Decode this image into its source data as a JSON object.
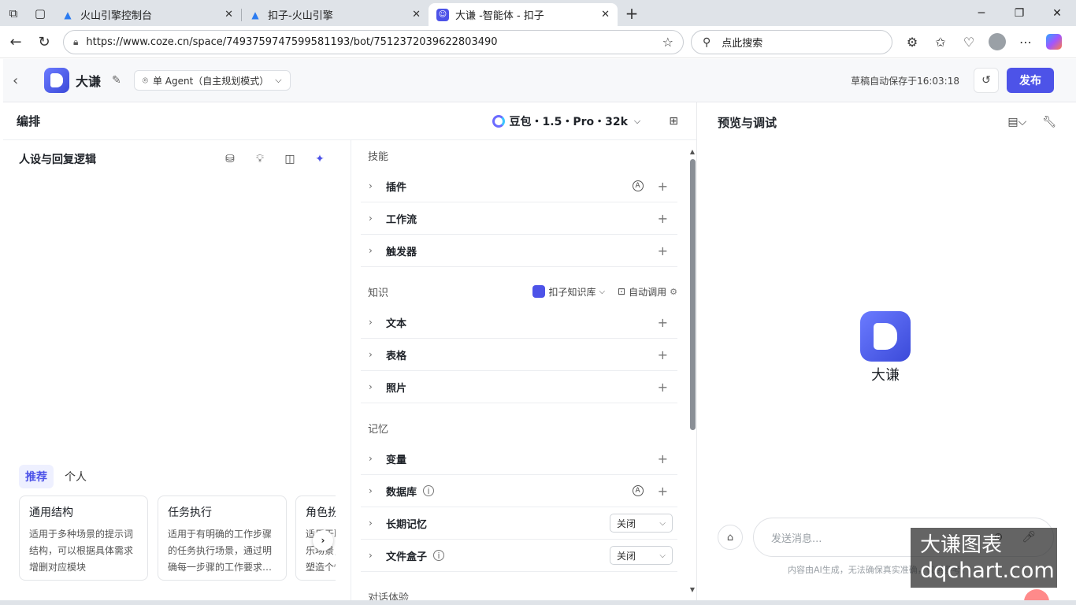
{
  "browser": {
    "tabs": [
      {
        "title": "火山引擎控制台",
        "icon": "volcano-icon",
        "active": false
      },
      {
        "title": "扣子-火山引擎",
        "icon": "volcano-icon",
        "active": false
      },
      {
        "title": "大谦 -智能体 - 扣子",
        "icon": "coze-icon",
        "active": true
      }
    ],
    "url": "https://www.coze.cn/space/7493759747599581193/bot/7512372039622803490",
    "search_placeholder": "点此搜索"
  },
  "header": {
    "bot_name": "大谦",
    "mode_label": "单 Agent（自主规划模式）",
    "autosave": "草稿自动保存于16:03:18",
    "publish_label": "发布"
  },
  "edit": {
    "title": "编排",
    "model": "豆包・1.5・Pro・32k"
  },
  "persona": {
    "title": "人设与回复逻辑",
    "tabs": [
      "推荐",
      "个人"
    ],
    "cards": [
      {
        "title": "通用结构",
        "desc": "适用于多种场景的提示词结构，可以根据具体需求增删对应模块"
      },
      {
        "title": "任务执行",
        "desc": "适用于有明确的工作步骤的任务执行场景，通过明确每一步骤的工作要求…"
      },
      {
        "title": "角色扮演",
        "desc": "适用于聊天陪伴、互动娱乐场景，可帮助你更好地塑造个性化的角色"
      }
    ]
  },
  "skills": {
    "skill_label": "技能",
    "skill_rows": [
      "插件",
      "工作流",
      "触发器"
    ],
    "knowledge_label": "知识",
    "knowledge_source": "扣子知识库",
    "knowledge_mode": "自动调用",
    "knowledge_rows": [
      "文本",
      "表格",
      "照片"
    ],
    "memory_label": "记忆",
    "memory_rows": {
      "variables": "变量",
      "database": "数据库",
      "long_term": "长期记忆",
      "long_term_value": "关闭",
      "filebox": "文件盒子",
      "filebox_value": "关闭"
    },
    "dialog_label": "对话体验"
  },
  "preview": {
    "title": "预览与调试",
    "bot_name": "大谦",
    "input_placeholder": "发送消息...",
    "disclaimer": "内容由AI生成，无法确保真实准确，仅供参考。",
    "watermark_line1": "大谦图表",
    "watermark_line2": "dqchart.com"
  }
}
